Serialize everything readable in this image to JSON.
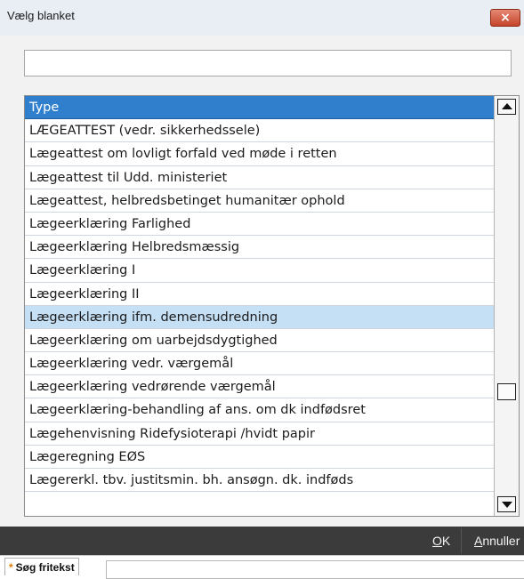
{
  "window": {
    "title": "Vælg blanket",
    "close_label": "×"
  },
  "search": {
    "value": "",
    "placeholder": ""
  },
  "list": {
    "header": "Type",
    "rows": [
      "LÆGEATTEST (vedr. sikkerhedssele)",
      "Lægeattest om lovligt forfald ved møde i retten",
      "Lægeattest til Udd. ministeriet",
      "Lægeattest, helbredsbetinget humanitær ophold",
      "Lægeerklæring Farlighed",
      "Lægeerklæring Helbredsmæssig",
      "Lægeerklæring I",
      "Lægeerklæring II",
      "Lægeerklæring ifm. demensudredning",
      "Lægeerklæring om uarbejdsdygtighed",
      "Lægeerklæring vedr. værgemål",
      "Lægeerklæring vedrørende værgemål",
      "Lægeerklæring-behandling af ans. om dk indfødsret",
      "Lægehenvisning Ridefysioterapi /hvidt papir",
      "Lægeregning EØS",
      "Lægererkl. tbv. justitsmin. bh. ansøgn. dk. indføds"
    ],
    "selected_index": 8
  },
  "footer": {
    "ok_mnemonic": "O",
    "ok_rest": "K",
    "cancel_mnemonic": "A",
    "cancel_rest": "nnuller"
  },
  "bottom": {
    "required_marker": "*",
    "search_tab_label": "Søg fritekst"
  },
  "colors": {
    "header": "#2f7fcd",
    "selected": "#c5dff5",
    "footer": "#3b3b3b",
    "close": "#c5432a"
  }
}
